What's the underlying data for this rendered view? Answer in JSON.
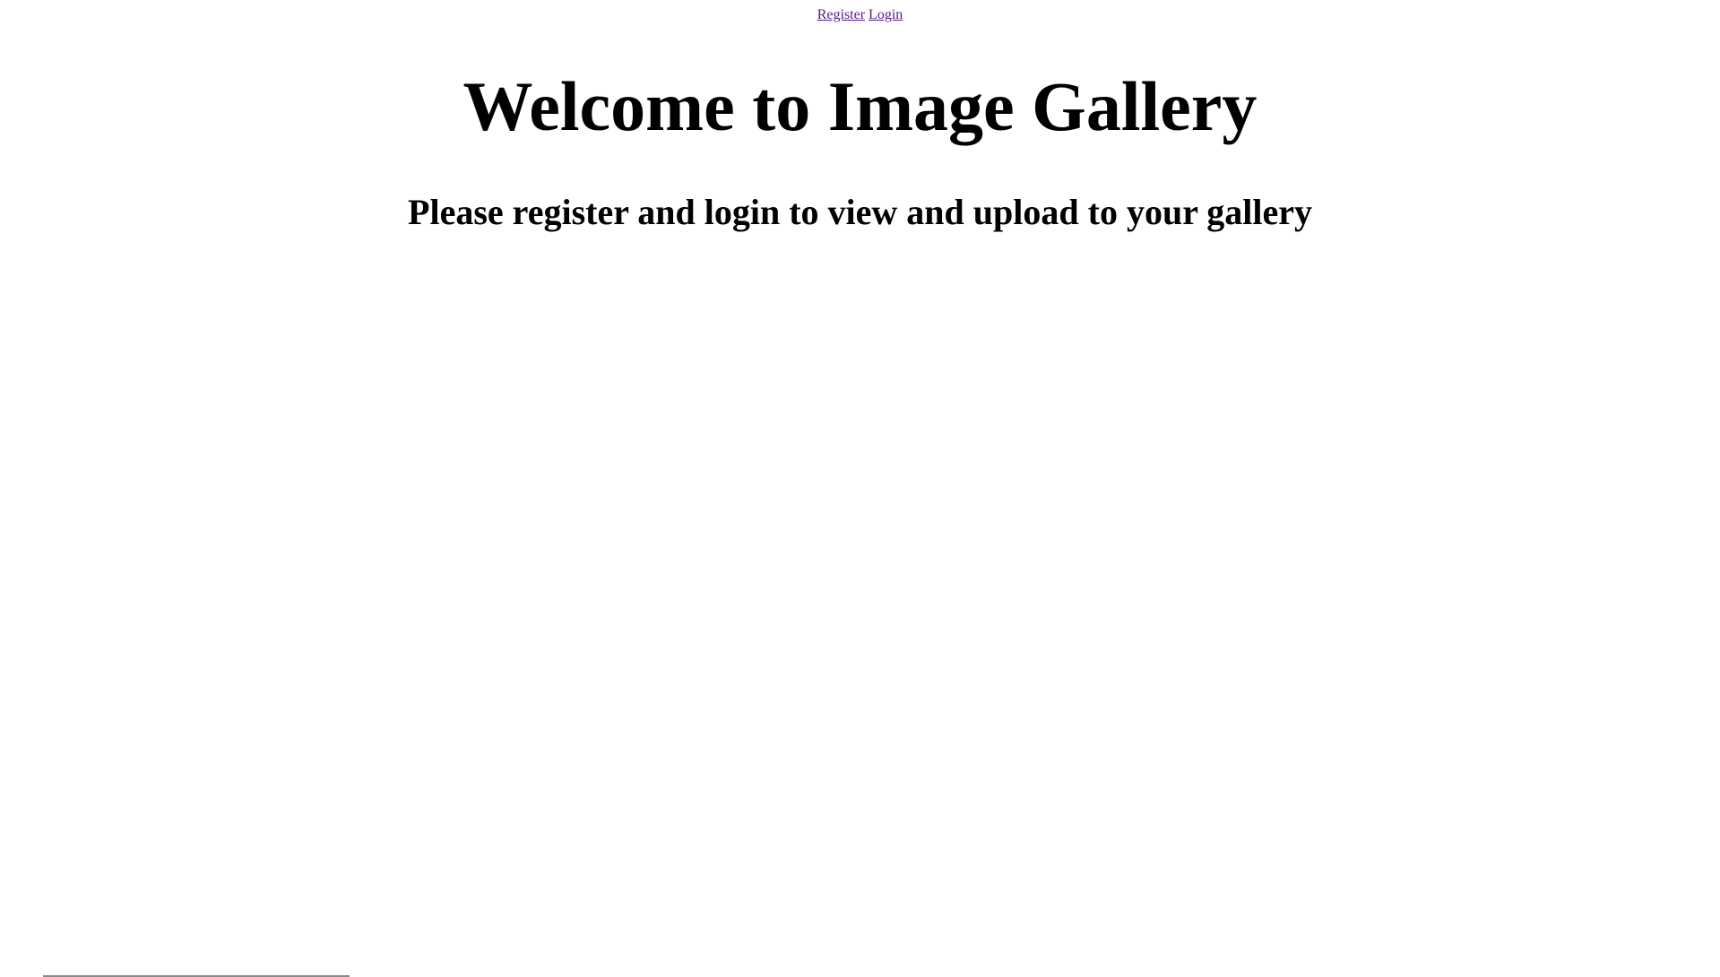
{
  "nav": {
    "register_label": "Register",
    "login_label": "Login",
    "link_color": "#551a8b"
  },
  "main": {
    "title": "Welcome to Image Gallery",
    "subtitle": "Please register and login to view and upload to your gallery"
  }
}
